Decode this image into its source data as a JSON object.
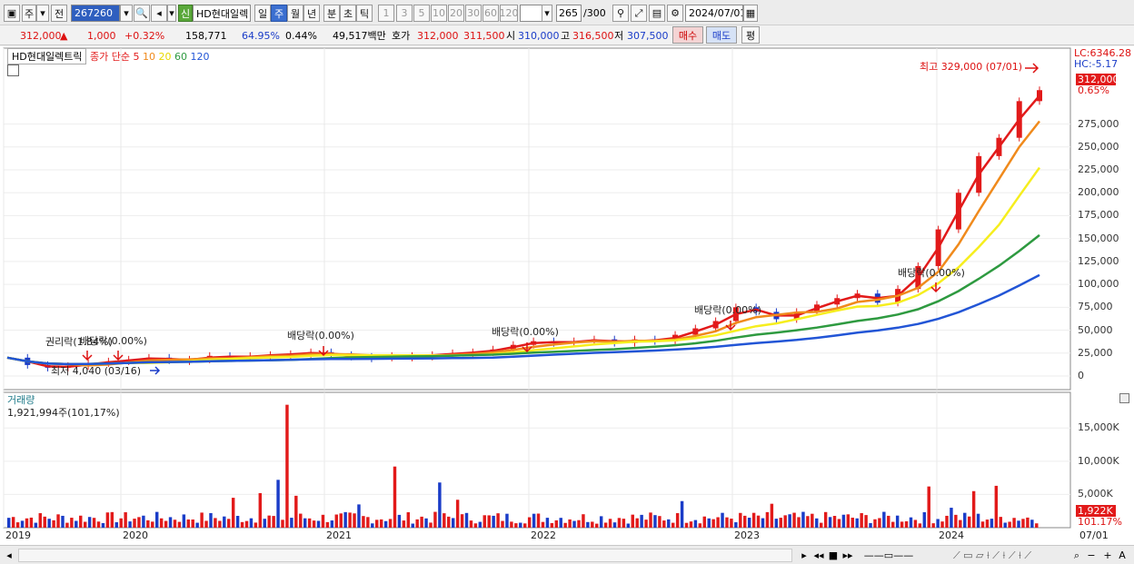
{
  "toolbar": {
    "period_mode": "주",
    "prev_label": "전",
    "code": "267260",
    "badge_new": "신",
    "stock_name": "HD현대일렉",
    "periods": [
      "일",
      "주",
      "월",
      "년",
      "분",
      "초",
      "틱"
    ],
    "selected_period": "주",
    "intervals": [
      "1",
      "3",
      "5",
      "10",
      "20",
      "30",
      "60",
      "120"
    ],
    "count_value": "265",
    "count_total": "/300",
    "date": "2024/07/01"
  },
  "quote": {
    "price": "312,000",
    "change_arrow": "▲",
    "change": "1,000",
    "change_pct": "+0.32%",
    "volume": "158,771",
    "vol_ratio": "64.95%",
    "turnover_pct": "0.44%",
    "amount": "49,517백만",
    "hoga_label": "호가",
    "ask": "312,000",
    "bid": "311,500",
    "open_label": "시",
    "open": "310,000",
    "high_label": "고",
    "high": "316,500",
    "low_label": "저",
    "low": "307,500",
    "buy_label": "매수",
    "sell_label": "매도",
    "eval_label": "평"
  },
  "price_pane": {
    "legend_name": "HD현대일렉트릭",
    "legend_ma": [
      "종가",
      "단순",
      "5",
      "10",
      "20",
      "60",
      "120"
    ],
    "lc_label": "LC:6346.28",
    "hc_label": "HC:-5.17",
    "current_price": "312,000",
    "current_pct": "0.65%",
    "y_ticks": [
      "275,000",
      "250,000",
      "225,000",
      "200,000",
      "175,000",
      "150,000",
      "125,000",
      "100,000",
      "75,000",
      "50,000",
      "25,000",
      "0"
    ],
    "max_marker": "최고 329,000 (07/01)",
    "min_marker": "최저 4,040 (03/16)",
    "events": [
      "권리락(1.84%)",
      "배당락(0.00%)",
      "배당락(0.00%)",
      "배당락(0.00%)",
      "배당락(0.00%)",
      "배당락(0.00%)",
      "배당락(0.00%)"
    ]
  },
  "volume_pane": {
    "title": "거래량",
    "info": "1,921,994주(101,17%)",
    "y_ticks": [
      "15,000K",
      "10,000K",
      "5,000K"
    ],
    "current": "1,922K",
    "current_pct": "101.17%"
  },
  "x_axis": {
    "labels": [
      "2019",
      "2020",
      "2021",
      "2022",
      "2023",
      "2024",
      "07/01"
    ]
  },
  "colors": {
    "up": "#e21a1a",
    "down": "#1a3cc8",
    "ma5": "#e21a1a",
    "ma10": "#f08a1c",
    "ma20": "#f6ee1e",
    "ma60": "#2e9a40",
    "ma120": "#2255d6"
  },
  "chart_data": {
    "type": "candlestick",
    "x": [
      "2019",
      "2020",
      "2021",
      "2022",
      "2023",
      "2024",
      "07/01"
    ],
    "close": [
      20000,
      12000,
      9000,
      11000,
      14000,
      16000,
      18000,
      20000,
      17000,
      18000,
      22000,
      20000,
      22000,
      23000,
      24000,
      26000,
      23000,
      21000,
      20000,
      22000,
      22000,
      23000,
      25000,
      26000,
      29000,
      34000,
      38000,
      36000,
      38000,
      40000,
      36000,
      40000,
      38000,
      45000,
      52000,
      60000,
      75000,
      70000,
      62000,
      70000,
      78000,
      85000,
      90000,
      80000,
      95000,
      120000,
      160000,
      200000,
      240000,
      260000,
      300000,
      312000
    ],
    "ylim": [
      0,
      340000
    ]
  }
}
